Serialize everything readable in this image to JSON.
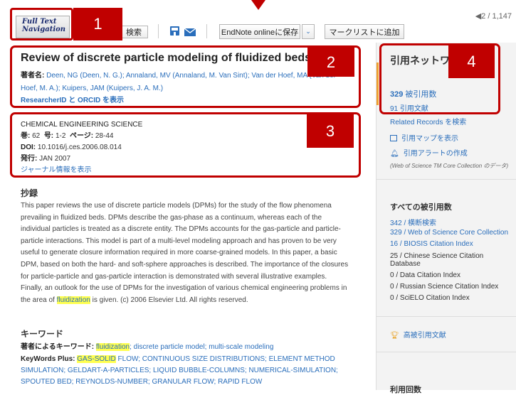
{
  "toolbar": {
    "logo_line1": "Full Text",
    "logo_line2": "Navigation",
    "search_label": "検索",
    "endnote_label": "EndNote onlineに保存",
    "marklist_label": "マークリストに追加",
    "pager": "◀2 / 1,147"
  },
  "callouts": [
    "1",
    "2",
    "3",
    "4"
  ],
  "record": {
    "title": "Review of discrete particle modeling of fluidized beds",
    "authors_label": "著者名:",
    "authors_line1": "Deen, NG (Deen, N. G.); Annaland, MV (Annaland, M. Van Sint); Van der Hoef, MA (Van der",
    "authors_line2": "Hoef, M. A.); Kuipers, JAM (Kuipers, J. A. M.)",
    "researcher_link": "ResearcherID と ORCID を表示"
  },
  "source": {
    "journal": "CHEMICAL ENGINEERING SCIENCE",
    "vol_label": "巻:",
    "vol": "62",
    "issue_label": "号:",
    "issue": "1-2",
    "pages_label": "ページ:",
    "pages": "28-44",
    "doi_label": "DOI:",
    "doi": "10.1016/j.ces.2006.08.014",
    "published_label": "発行:",
    "published": "JAN 2007",
    "journal_info_link": "ジャーナル情報を表示"
  },
  "abstract": {
    "heading": "抄録",
    "text_before": "This paper reviews the use of discrete particle models (DPMs) for the study of the flow phenomena prevailing in fluidized beds. DPMs describe the gas-phase as a continuum, whereas each of the individual particles is treated as a discrete entity. The DPMs accounts for the gas-particle and particle-particle interactions. This model is part of a multi-level modeling approach and has proven to be very useful to generate closure information required in more coarse-grained models. In this paper, a basic DPM, based on both the hard- and soft-sphere approaches is described. The importance of the closures for particle-particle and gas-particle interaction is demonstrated with several illustrative examples. Finally, an outlook for the use of DPMs for the investigation of various chemical engineering problems in the area of ",
    "highlight": "fluidization",
    "text_after": " is given. (c) 2006 Elsevier Ltd. All rights reserved."
  },
  "keywords": {
    "heading": "キーワード",
    "author_label": "著者によるキーワード:",
    "author_highlight": "fluidization",
    "author_rest": "; discrete particle model; multi-scale modeling",
    "plus_label": "KeyWords Plus:",
    "plus_highlight": "GAS-SOLID",
    "plus_line1_rest": " FLOW; CONTINUOUS SIZE DISTRIBUTIONS; ELEMENT METHOD",
    "plus_line2": "SIMULATION; GELDART-A-PARTICLES; LIQUID BUBBLE-COLUMNS; NUMERICAL-SIMULATION;",
    "plus_line3": "SPOUTED BED; REYNOLDS-NUMBER; GRANULAR FLOW; RAPID FLOW"
  },
  "citation_network": {
    "title": "引用ネットワーク",
    "times_cited_count": "329",
    "times_cited_label": "被引用数",
    "cited_refs": "91 引用文献",
    "related_records": "Related Records を検索",
    "citation_map": "引用マップを表示",
    "citation_alert": "引用アラートの作成",
    "wos_note": "(Web of Science TM Core Collection のデータ)"
  },
  "all_times_cited": {
    "heading": "すべての被引用数",
    "items": [
      "342 / 横断検索",
      "329 / Web of Science Core Collection",
      "16 / BIOSIS Citation Index",
      "25 / Chinese Science Citation",
      "Database",
      "0 / Data Citation Index",
      "0 / Russian Science Citation Index",
      "0 / SciELO Citation Index"
    ],
    "highly_cited": "高被引用文献",
    "usage_heading": "利用回数"
  }
}
